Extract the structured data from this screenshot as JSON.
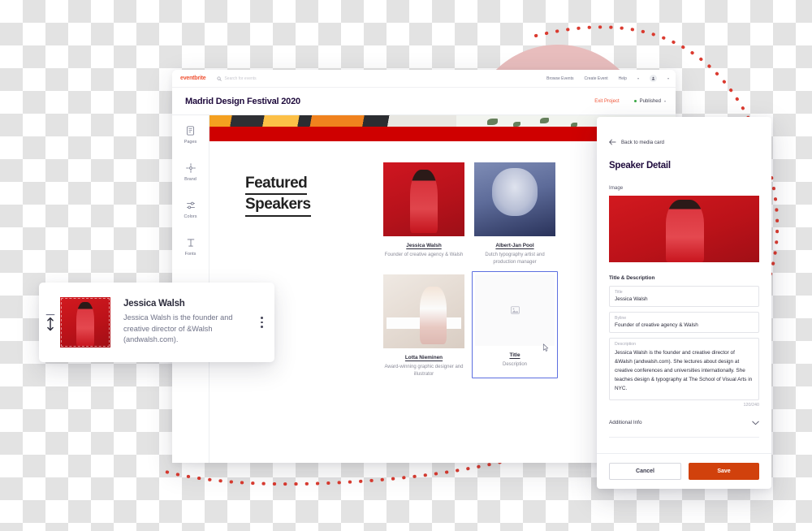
{
  "colors": {
    "brand_orange": "#f05537",
    "save_orange": "#d1410c",
    "published_green": "#39a845",
    "selected_blue": "#5c6fe0",
    "banner_red": "#cf0000",
    "pink_circle": "#e8bdbd",
    "dot_arc_red": "#d93025"
  },
  "eventbrite_nav": {
    "logo": "eventbrite",
    "search_icon": "search-icon",
    "search_placeholder": "Search for events",
    "links": [
      "Browse Events",
      "Create Event",
      "Help"
    ],
    "avatar_icon": "user-avatar-icon",
    "chevron": "⌄"
  },
  "project_bar": {
    "title": "Madrid Design Festival 2020",
    "exit_label": "Exit Project",
    "status_label": "Published",
    "status_chevron": "⌄"
  },
  "tool_rail": {
    "items": [
      {
        "label": "Pages",
        "icon": "pages-icon"
      },
      {
        "label": "Brand",
        "icon": "brand-icon"
      },
      {
        "label": "Colors",
        "icon": "colors-icon"
      },
      {
        "label": "Fonts",
        "icon": "fonts-icon"
      }
    ]
  },
  "canvas": {
    "heading_line1": "Featured",
    "heading_line2": "Speakers",
    "speakers": [
      {
        "name": "Jessica Walsh",
        "desc": "Founder of creative agency & Walsh",
        "photo": "jessica-walsh-photo"
      },
      {
        "name": "Albert-Jan Pool",
        "desc": "Dutch typography artist and production manager",
        "photo": "albert-jan-pool-photo"
      },
      {
        "name": "Lotta Nieminen",
        "desc": "Award-winning graphic designer and illustrator",
        "photo": "lotta-nieminen-photo"
      },
      {
        "name": "Title",
        "desc": "Description",
        "photo": "image-placeholder-icon"
      }
    ]
  },
  "detail_panel": {
    "back_label": "Back to media card",
    "back_icon": "arrow-left-icon",
    "title": "Speaker Detail",
    "image_label": "Image",
    "image_alt": "jessica-walsh-photo",
    "group_label": "Title & Description",
    "fields": [
      {
        "label": "Title",
        "value": "Jessica Walsh"
      },
      {
        "label": "Byline",
        "value": "Founder of creative agency & Walsh"
      }
    ],
    "description": {
      "label": "Description",
      "value": "Jessica Walsh is the founder and creative director of &Walsh (andwalsh.com). She lectures about design at creative conferences and universities internationally. She teaches design & typography at The School of Visual Arts in NYC.",
      "counter": "120/240"
    },
    "additional_info": {
      "label": "Additional Info",
      "chevron_icon": "chevron-down-icon"
    },
    "cancel_label": "Cancel",
    "save_label": "Save"
  },
  "media_card": {
    "drag_icon": "drag-handle-icon",
    "thumb_alt": "jessica-walsh-thumbnail",
    "title": "Jessica Walsh",
    "desc": "Jessica Walsh is the founder and creative director of &Walsh (andwalsh.com).",
    "menu_icon": "more-options-icon"
  }
}
